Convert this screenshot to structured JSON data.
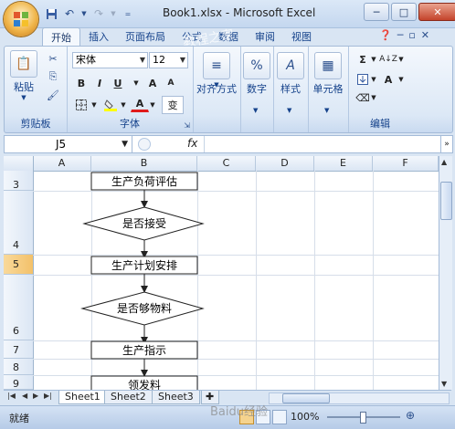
{
  "window": {
    "title": "Book1.xlsx - Microsoft Excel",
    "minimize": "─",
    "restore": "□",
    "close": "✕"
  },
  "quick_access": [
    "save",
    "undo",
    "redo",
    "customize"
  ],
  "tabs": [
    "开始",
    "插入",
    "页面布局",
    "公式",
    "数据",
    "审阅",
    "视图"
  ],
  "active_tab": "开始",
  "ribbon": {
    "clipboard": {
      "label": "剪贴板",
      "paste": "粘贴"
    },
    "font": {
      "label": "字体",
      "name": "宋体",
      "size": "12",
      "bold": "B",
      "italic": "I",
      "underline": "U",
      "grow": "A",
      "shrink": "A",
      "font_color_letter": "A",
      "phonetic": "变"
    },
    "alignment": {
      "label": "对齐方式"
    },
    "number": {
      "label": "数字",
      "glyph": "%"
    },
    "styles": {
      "label": "样式",
      "glyph": "A"
    },
    "cells": {
      "label": "单元格"
    },
    "editing": {
      "label": "编辑",
      "sum": "Σ",
      "sort": "A↓Z",
      "find": "A"
    }
  },
  "formula_bar": {
    "name_box": "J5",
    "fx": "fx",
    "content": ""
  },
  "columns": [
    "A",
    "B",
    "C",
    "D",
    "E",
    "F"
  ],
  "rows": [
    "3",
    "4",
    "5",
    "6",
    "7",
    "8",
    "9"
  ],
  "selected_row": "5",
  "flowchart": {
    "steps": [
      "生产负荷评估",
      "是否接受",
      "生产计划安排",
      "是否够物料",
      "生产指示",
      "领发料"
    ]
  },
  "sheets": [
    "Sheet1",
    "Sheet2",
    "Sheet3"
  ],
  "active_sheet": "Sheet1",
  "status": {
    "text": "就绪",
    "zoom": "100%"
  },
  "watermarks": {
    "baidu": "Baidu经验",
    "site": "教程之家"
  }
}
